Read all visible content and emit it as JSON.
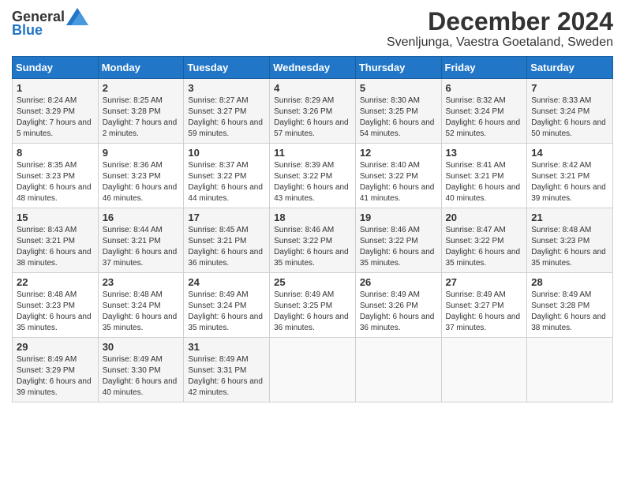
{
  "logo": {
    "general": "General",
    "blue": "Blue"
  },
  "header": {
    "title": "December 2024",
    "subtitle": "Svenljunga, Vaestra Goetaland, Sweden"
  },
  "days_of_week": [
    "Sunday",
    "Monday",
    "Tuesday",
    "Wednesday",
    "Thursday",
    "Friday",
    "Saturday"
  ],
  "weeks": [
    [
      {
        "day": "1",
        "sunrise": "Sunrise: 8:24 AM",
        "sunset": "Sunset: 3:29 PM",
        "daylight": "Daylight: 7 hours and 5 minutes."
      },
      {
        "day": "2",
        "sunrise": "Sunrise: 8:25 AM",
        "sunset": "Sunset: 3:28 PM",
        "daylight": "Daylight: 7 hours and 2 minutes."
      },
      {
        "day": "3",
        "sunrise": "Sunrise: 8:27 AM",
        "sunset": "Sunset: 3:27 PM",
        "daylight": "Daylight: 6 hours and 59 minutes."
      },
      {
        "day": "4",
        "sunrise": "Sunrise: 8:29 AM",
        "sunset": "Sunset: 3:26 PM",
        "daylight": "Daylight: 6 hours and 57 minutes."
      },
      {
        "day": "5",
        "sunrise": "Sunrise: 8:30 AM",
        "sunset": "Sunset: 3:25 PM",
        "daylight": "Daylight: 6 hours and 54 minutes."
      },
      {
        "day": "6",
        "sunrise": "Sunrise: 8:32 AM",
        "sunset": "Sunset: 3:24 PM",
        "daylight": "Daylight: 6 hours and 52 minutes."
      },
      {
        "day": "7",
        "sunrise": "Sunrise: 8:33 AM",
        "sunset": "Sunset: 3:24 PM",
        "daylight": "Daylight: 6 hours and 50 minutes."
      }
    ],
    [
      {
        "day": "8",
        "sunrise": "Sunrise: 8:35 AM",
        "sunset": "Sunset: 3:23 PM",
        "daylight": "Daylight: 6 hours and 48 minutes."
      },
      {
        "day": "9",
        "sunrise": "Sunrise: 8:36 AM",
        "sunset": "Sunset: 3:23 PM",
        "daylight": "Daylight: 6 hours and 46 minutes."
      },
      {
        "day": "10",
        "sunrise": "Sunrise: 8:37 AM",
        "sunset": "Sunset: 3:22 PM",
        "daylight": "Daylight: 6 hours and 44 minutes."
      },
      {
        "day": "11",
        "sunrise": "Sunrise: 8:39 AM",
        "sunset": "Sunset: 3:22 PM",
        "daylight": "Daylight: 6 hours and 43 minutes."
      },
      {
        "day": "12",
        "sunrise": "Sunrise: 8:40 AM",
        "sunset": "Sunset: 3:22 PM",
        "daylight": "Daylight: 6 hours and 41 minutes."
      },
      {
        "day": "13",
        "sunrise": "Sunrise: 8:41 AM",
        "sunset": "Sunset: 3:21 PM",
        "daylight": "Daylight: 6 hours and 40 minutes."
      },
      {
        "day": "14",
        "sunrise": "Sunrise: 8:42 AM",
        "sunset": "Sunset: 3:21 PM",
        "daylight": "Daylight: 6 hours and 39 minutes."
      }
    ],
    [
      {
        "day": "15",
        "sunrise": "Sunrise: 8:43 AM",
        "sunset": "Sunset: 3:21 PM",
        "daylight": "Daylight: 6 hours and 38 minutes."
      },
      {
        "day": "16",
        "sunrise": "Sunrise: 8:44 AM",
        "sunset": "Sunset: 3:21 PM",
        "daylight": "Daylight: 6 hours and 37 minutes."
      },
      {
        "day": "17",
        "sunrise": "Sunrise: 8:45 AM",
        "sunset": "Sunset: 3:21 PM",
        "daylight": "Daylight: 6 hours and 36 minutes."
      },
      {
        "day": "18",
        "sunrise": "Sunrise: 8:46 AM",
        "sunset": "Sunset: 3:22 PM",
        "daylight": "Daylight: 6 hours and 35 minutes."
      },
      {
        "day": "19",
        "sunrise": "Sunrise: 8:46 AM",
        "sunset": "Sunset: 3:22 PM",
        "daylight": "Daylight: 6 hours and 35 minutes."
      },
      {
        "day": "20",
        "sunrise": "Sunrise: 8:47 AM",
        "sunset": "Sunset: 3:22 PM",
        "daylight": "Daylight: 6 hours and 35 minutes."
      },
      {
        "day": "21",
        "sunrise": "Sunrise: 8:48 AM",
        "sunset": "Sunset: 3:23 PM",
        "daylight": "Daylight: 6 hours and 35 minutes."
      }
    ],
    [
      {
        "day": "22",
        "sunrise": "Sunrise: 8:48 AM",
        "sunset": "Sunset: 3:23 PM",
        "daylight": "Daylight: 6 hours and 35 minutes."
      },
      {
        "day": "23",
        "sunrise": "Sunrise: 8:48 AM",
        "sunset": "Sunset: 3:24 PM",
        "daylight": "Daylight: 6 hours and 35 minutes."
      },
      {
        "day": "24",
        "sunrise": "Sunrise: 8:49 AM",
        "sunset": "Sunset: 3:24 PM",
        "daylight": "Daylight: 6 hours and 35 minutes."
      },
      {
        "day": "25",
        "sunrise": "Sunrise: 8:49 AM",
        "sunset": "Sunset: 3:25 PM",
        "daylight": "Daylight: 6 hours and 36 minutes."
      },
      {
        "day": "26",
        "sunrise": "Sunrise: 8:49 AM",
        "sunset": "Sunset: 3:26 PM",
        "daylight": "Daylight: 6 hours and 36 minutes."
      },
      {
        "day": "27",
        "sunrise": "Sunrise: 8:49 AM",
        "sunset": "Sunset: 3:27 PM",
        "daylight": "Daylight: 6 hours and 37 minutes."
      },
      {
        "day": "28",
        "sunrise": "Sunrise: 8:49 AM",
        "sunset": "Sunset: 3:28 PM",
        "daylight": "Daylight: 6 hours and 38 minutes."
      }
    ],
    [
      {
        "day": "29",
        "sunrise": "Sunrise: 8:49 AM",
        "sunset": "Sunset: 3:29 PM",
        "daylight": "Daylight: 6 hours and 39 minutes."
      },
      {
        "day": "30",
        "sunrise": "Sunrise: 8:49 AM",
        "sunset": "Sunset: 3:30 PM",
        "daylight": "Daylight: 6 hours and 40 minutes."
      },
      {
        "day": "31",
        "sunrise": "Sunrise: 8:49 AM",
        "sunset": "Sunset: 3:31 PM",
        "daylight": "Daylight: 6 hours and 42 minutes."
      },
      null,
      null,
      null,
      null
    ]
  ]
}
